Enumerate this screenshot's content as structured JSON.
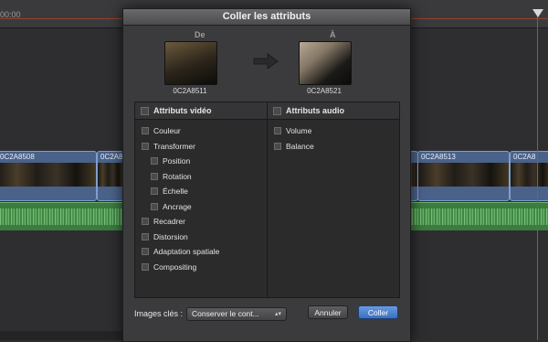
{
  "timeline": {
    "ruler_time": "00:00",
    "clips": [
      {
        "label": "0C2A8508"
      },
      {
        "label": "0C2A8"
      },
      {
        "label": "0C2A8513"
      },
      {
        "label": "0C2A8"
      }
    ]
  },
  "dialog": {
    "title": "Coller les attributs",
    "source_label": "De",
    "destination_label": "À",
    "source_clip": "0C2A8511",
    "destination_clip": "0C2A8521",
    "video": {
      "header": "Attributs vidéo",
      "items": [
        {
          "label": "Couleur"
        },
        {
          "label": "Transformer"
        },
        {
          "label": "Position"
        },
        {
          "label": "Rotation"
        },
        {
          "label": "Échelle"
        },
        {
          "label": "Ancrage"
        },
        {
          "label": "Recadrer"
        },
        {
          "label": "Distorsion"
        },
        {
          "label": "Adaptation spatiale"
        },
        {
          "label": "Compositing"
        }
      ]
    },
    "audio": {
      "header": "Attributs audio",
      "items": [
        {
          "label": "Volume"
        },
        {
          "label": "Balance"
        }
      ]
    },
    "keyframes_label": "Images clés :",
    "keyframes_value": "Conserver le cont...",
    "cancel_label": "Annuler",
    "paste_label": "Coller"
  },
  "colors": {
    "accent_button": "#3a6fbf",
    "playhead": "#d23b2b",
    "video_clip": "#4a628a",
    "audio_clip": "#3d7b40"
  }
}
